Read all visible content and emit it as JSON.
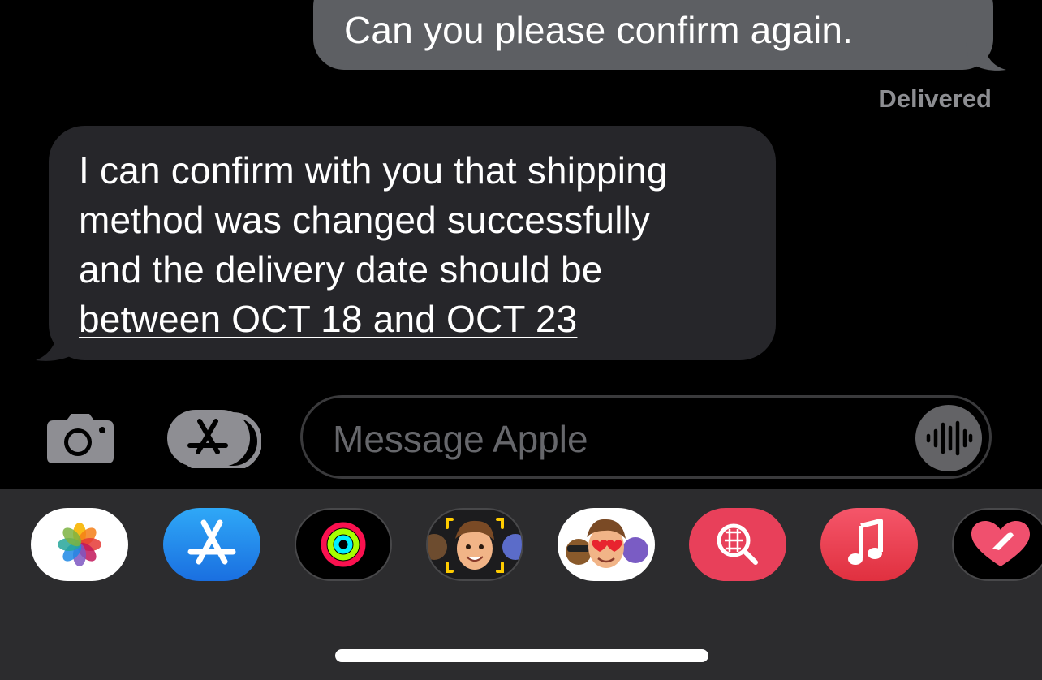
{
  "conversation": {
    "sent_message": "Can you please confirm again.",
    "delivery_status": "Delivered",
    "received_message": {
      "lines": [
        "I can confirm with you that shipping",
        "method was changed successfully",
        "and the delivery date should be"
      ],
      "link_line": "between OCT 18 and OCT 23"
    }
  },
  "compose": {
    "placeholder": "Message Apple",
    "camera_icon": "camera-icon",
    "apps_icon": "app-store-icon",
    "voice_icon": "waveform-icon"
  },
  "app_drawer": {
    "apps": [
      {
        "name": "Photos",
        "icon": "photos-icon"
      },
      {
        "name": "App Store",
        "icon": "app-store-icon"
      },
      {
        "name": "Activity",
        "icon": "activity-rings-icon"
      },
      {
        "name": "Memoji Camera",
        "icon": "memoji-camera-icon"
      },
      {
        "name": "Memoji Stickers",
        "icon": "memoji-stickers-icon"
      },
      {
        "name": "Images Search",
        "icon": "image-search-icon"
      },
      {
        "name": "Music",
        "icon": "music-note-icon"
      },
      {
        "name": "Digital Touch",
        "icon": "digital-touch-heart-icon"
      }
    ]
  },
  "colors": {
    "background": "#000000",
    "sent_bubble": "#5d5f63",
    "received_bubble": "#26262a",
    "drawer": "#2c2c2e",
    "delivered_text": "#8d8e92",
    "placeholder_text": "#66676b"
  }
}
